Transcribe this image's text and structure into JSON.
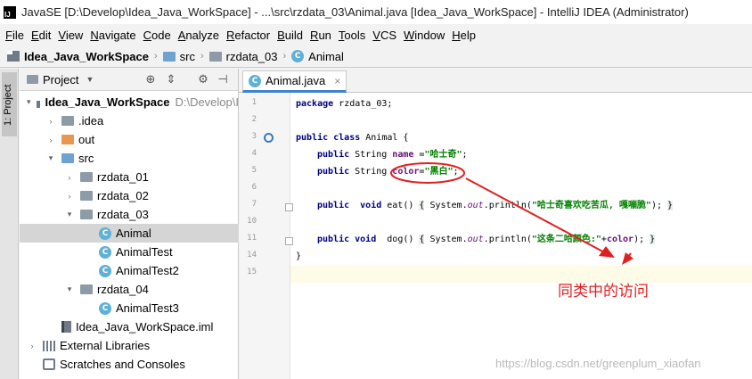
{
  "window": {
    "app_icon": "IJ",
    "title": "JavaSE [D:\\Develop\\Idea_Java_WorkSpace] - ...\\src\\rzdata_03\\Animal.java [Idea_Java_WorkSpace] - IntelliJ IDEA (Administrator)"
  },
  "menu": [
    "File",
    "Edit",
    "View",
    "Navigate",
    "Code",
    "Analyze",
    "Refactor",
    "Build",
    "Run",
    "Tools",
    "VCS",
    "Window",
    "Help"
  ],
  "breadcrumb": [
    "Idea_Java_WorkSpace",
    "src",
    "rzdata_03",
    "Animal"
  ],
  "side_tab": "1: Project",
  "project_panel": {
    "title": "Project",
    "tree": [
      {
        "label": "Idea_Java_WorkSpace",
        "path": "D:\\Develop\\I",
        "icon": "module-icon",
        "arrow": "▾",
        "indent": 0,
        "bold": true
      },
      {
        "label": ".idea",
        "icon": "folder-icon",
        "arrow": "›",
        "indent": 1
      },
      {
        "label": "out",
        "icon": "folder-orange-icon",
        "arrow": "›",
        "indent": 1
      },
      {
        "label": "src",
        "icon": "source-folder-icon",
        "arrow": "▾",
        "indent": 1
      },
      {
        "label": "rzdata_01",
        "icon": "package-icon",
        "arrow": "›",
        "indent": 2
      },
      {
        "label": "rzdata_02",
        "icon": "package-icon",
        "arrow": "›",
        "indent": 2
      },
      {
        "label": "rzdata_03",
        "icon": "package-icon",
        "arrow": "▾",
        "indent": 2
      },
      {
        "label": "Animal",
        "icon": "class-icon",
        "arrow": "",
        "indent": 3,
        "selected": true
      },
      {
        "label": "AnimalTest",
        "icon": "class-icon",
        "arrow": "",
        "indent": 3
      },
      {
        "label": "AnimalTest2",
        "icon": "class-icon",
        "arrow": "",
        "indent": 3
      },
      {
        "label": "rzdata_04",
        "icon": "package-icon",
        "arrow": "▾",
        "indent": 2
      },
      {
        "label": "AnimalTest3",
        "icon": "class-icon",
        "arrow": "",
        "indent": 3
      },
      {
        "label": "Idea_Java_WorkSpace.iml",
        "icon": "iml-file-icon",
        "arrow": "",
        "indent": 1
      },
      {
        "label": "External Libraries",
        "icon": "libraries-icon",
        "arrow": "›",
        "indent": 0
      },
      {
        "label": "Scratches and Consoles",
        "icon": "scratches-icon",
        "arrow": "",
        "indent": 0
      }
    ]
  },
  "editor": {
    "tab_label": "Animal.java",
    "line_numbers": [
      "1",
      "2",
      "3",
      "4",
      "5",
      "6",
      "7",
      "10",
      "11",
      "14",
      "15"
    ],
    "code": {
      "l1_kw": "package",
      "l1_rest": " rzdata_03;",
      "l3_kw": "public class",
      "l3_rest": " Animal {",
      "l4_kw": "public",
      "l4_type": " String ",
      "l4_field": "name",
      "l4_eq": " =",
      "l4_str": "\"哈士奇\"",
      "l4_end": ";",
      "l5_kw": "public",
      "l5_type": " String ",
      "l5_field": "color",
      "l5_eq": "=",
      "l5_str": "\"黑白\"",
      "l5_end": ";",
      "l7_kw": "public",
      "l7_kw2": "  void",
      "l7_mid": " eat() ",
      "l7_b1": "{",
      "l7_sys": " System.",
      "l7_out": "out",
      "l7_call": ".println(",
      "l7_str": "\"哈士奇喜欢吃苦瓜, 嘎嘣脆\"",
      "l7_end": "); ",
      "l7_b2": "}",
      "l11_kw": "public",
      "l11_kw2": " void",
      "l11_mid": "  dog() ",
      "l11_b1": "{",
      "l11_sys": " System.",
      "l11_out": "out",
      "l11_call": ".println(",
      "l11_str": "\"这条二哈颜色:\"",
      "l11_plus": "+",
      "l11_field": "color",
      "l11_end": "); ",
      "l11_b2": "}",
      "l14": "}"
    }
  },
  "annotation": {
    "text": "同类中的访问",
    "color": "#e02020"
  },
  "watermark": "https://blog.csdn.net/greenplum_xiaofan"
}
